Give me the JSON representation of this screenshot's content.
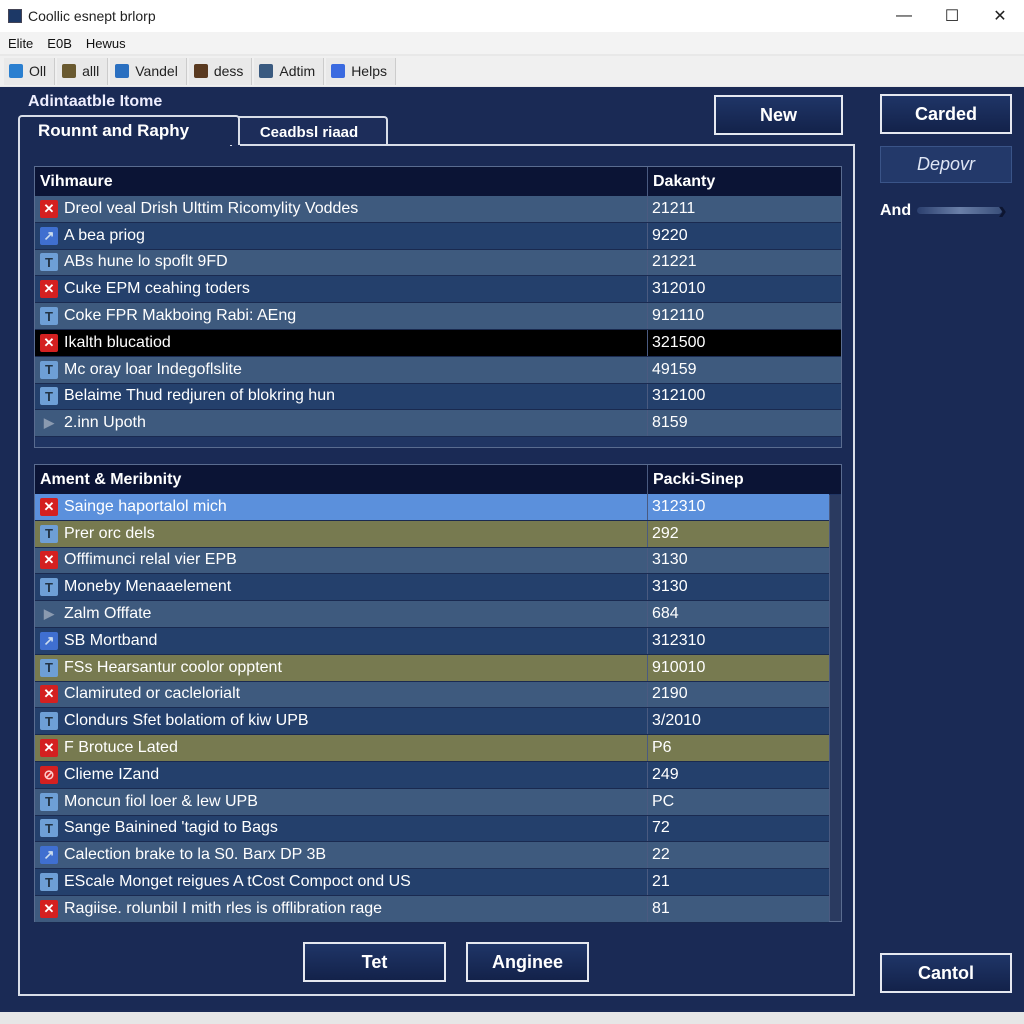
{
  "window": {
    "title": "Coollic esnept brlorp",
    "minimize": "—",
    "maximize": "☐",
    "close": "✕"
  },
  "menu": [
    "Elite",
    "E0B",
    "Hewus"
  ],
  "toolbar": [
    {
      "label": "Oll",
      "icon": "folder-icon",
      "color": "#2a7fd0"
    },
    {
      "label": "alll",
      "icon": "database-icon",
      "color": "#6a5a30"
    },
    {
      "label": "Vandel",
      "icon": "home-icon",
      "color": "#2a6fc0"
    },
    {
      "label": "dess",
      "icon": "disc-icon",
      "color": "#5a3a20"
    },
    {
      "label": "Adtim",
      "icon": "tools-icon",
      "color": "#3a5a80"
    },
    {
      "label": "Helps",
      "icon": "help-icon",
      "color": "#3a6ae0"
    }
  ],
  "heading": "Adintaatble Itome",
  "tabs": [
    "Rounnt and Raphy",
    "Ceadbsl riaad"
  ],
  "table1": {
    "headers": [
      "Vihmaure",
      "Dakanty"
    ],
    "rows": [
      {
        "icon": "x",
        "name": "Dreol veal Drish Ulttim Ricomylity Voddes",
        "value": "21211",
        "bg": "l"
      },
      {
        "icon": "c",
        "name": "A bea priog",
        "value": "9220",
        "bg": "d"
      },
      {
        "icon": "f",
        "name": "ABs hune lo spoflt 9FD",
        "value": "21221",
        "bg": "l"
      },
      {
        "icon": "x",
        "name": "Cuke EPM ceahing toders",
        "value": "312010",
        "bg": "d"
      },
      {
        "icon": "f",
        "name": "Coke FPR Makboing Rabi: AEng",
        "value": "912110",
        "bg": "l"
      },
      {
        "icon": "x",
        "name": "Ikalth blucatiod",
        "value": "321500",
        "bg": "k"
      },
      {
        "icon": "f",
        "name": "Mc oray loar Indegoflslite",
        "value": "49159",
        "bg": "l"
      },
      {
        "icon": "f",
        "name": "Belaime Thud redjuren of blokring hun",
        "value": "312100",
        "bg": "d"
      },
      {
        "icon": "a",
        "name": "2.inn Upoth",
        "value": "8159",
        "bg": "l"
      }
    ]
  },
  "table2": {
    "headers": [
      "Ament & Meribnity",
      "Packi-Sinep"
    ],
    "rows": [
      {
        "icon": "x",
        "name": "Sainge haportalol mich",
        "value": "312310",
        "bg": "s"
      },
      {
        "icon": "f",
        "name": "Prer orc dels",
        "value": "292",
        "bg": "o"
      },
      {
        "icon": "x",
        "name": "Offfimunci relal vier EPB",
        "value": "3130",
        "bg": "l"
      },
      {
        "icon": "f",
        "name": "Moneby Menaaelement",
        "value": "3130",
        "bg": "d"
      },
      {
        "icon": "a",
        "name": "Zalm Offfate",
        "value": "684",
        "bg": "l"
      },
      {
        "icon": "c",
        "name": "SB Mortband",
        "value": "312310",
        "bg": "d"
      },
      {
        "icon": "f",
        "name": "FSs Hearsantur coolor opptent",
        "value": "910010",
        "bg": "o"
      },
      {
        "icon": "x",
        "name": "Clamiruted or caclelorialt",
        "value": "2190",
        "bg": "l"
      },
      {
        "icon": "f",
        "name": "Clondurs Sfet bolatiom of kiw UPB",
        "value": "3/2010",
        "bg": "d"
      },
      {
        "icon": "x",
        "name": "F Brotuce Lated",
        "value": "P6",
        "bg": "o"
      },
      {
        "icon": "r",
        "name": "Clieme IZand",
        "value": "249",
        "bg": "d"
      },
      {
        "icon": "f",
        "name": "Moncun fiol loer & lew UPB",
        "value": "PC",
        "bg": "l"
      },
      {
        "icon": "f",
        "name": "Sange Bainined 'tagid to Bags",
        "value": "72",
        "bg": "d"
      },
      {
        "icon": "c",
        "name": "Calection brake to la S0. Barx DP 3B",
        "value": "22",
        "bg": "l"
      },
      {
        "icon": "f",
        "name": "EScale Monget reigues A tCost Compoct ond US",
        "value": "21",
        "bg": "d"
      },
      {
        "icon": "x",
        "name": "Ragiise. rolunbil I mith rles is offlibration rage",
        "value": "81",
        "bg": "l"
      }
    ]
  },
  "buttons": {
    "new": "New",
    "carded": "Carded",
    "depovr": "Depovr",
    "and": "And",
    "tet": "Tet",
    "anginee": "Anginee",
    "cantol": "Cantol"
  },
  "icon_glyphs": {
    "x": "✕",
    "f": "T",
    "c": "↗",
    "a": "▶",
    "r": "⊘"
  }
}
